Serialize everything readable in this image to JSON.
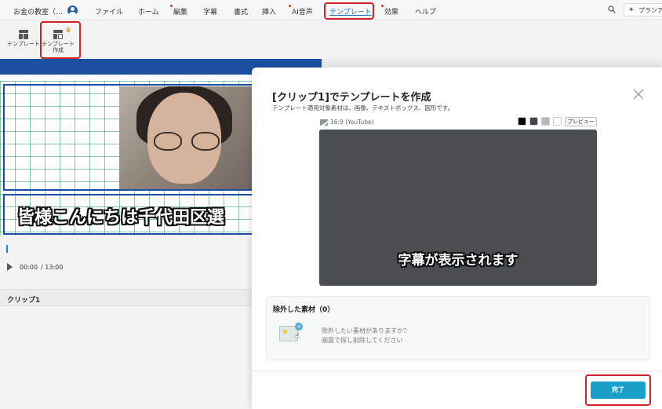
{
  "menubar": {
    "project_title": "お金の教室（…",
    "items": [
      {
        "label": "ファイル",
        "new": false
      },
      {
        "label": "ホーム",
        "new": false
      },
      {
        "label": "編集",
        "new": true
      },
      {
        "label": "字幕",
        "new": false
      },
      {
        "label": "書式",
        "new": false
      },
      {
        "label": "挿入",
        "new": false
      },
      {
        "label": "AI音声",
        "new": true
      },
      {
        "label": "テンプレート",
        "new": false,
        "active": true
      },
      {
        "label": "効果",
        "new": true
      },
      {
        "label": "ヘルプ",
        "new": false
      }
    ],
    "plan_label": "プランア"
  },
  "toolbar": {
    "template_label": "テンプレート",
    "create_label_line1": "テンプレート",
    "create_label_line2": "作成"
  },
  "editor": {
    "caption": "皆様こんにちは千代田区選",
    "time_current": "00:00",
    "time_total": "/ 13:00",
    "clip_label": "クリップ1"
  },
  "dialog": {
    "title": "[クリップ1]でテンプレートを作成",
    "subtitle": "テンプレート適用対象素材は、画像、テキストボックス、図形です。",
    "aspect_ratio": "16:9 (YouTube)",
    "swatches": [
      "#000000",
      "#40464b",
      "#b8b8b8",
      "#ffffff"
    ],
    "preview_button": "プレビュー",
    "preview_caption": "字幕が表示されます",
    "excluded": {
      "title": "除外した素材（0）",
      "message_line1": "除外したい素材がありますか？",
      "message_line2": "画面で探し削除してください"
    },
    "done_button": "完了"
  },
  "colors": {
    "accent_blue": "#1b4fa0",
    "highlight_red": "#d0222a",
    "primary_button": "#1a9fc9"
  }
}
